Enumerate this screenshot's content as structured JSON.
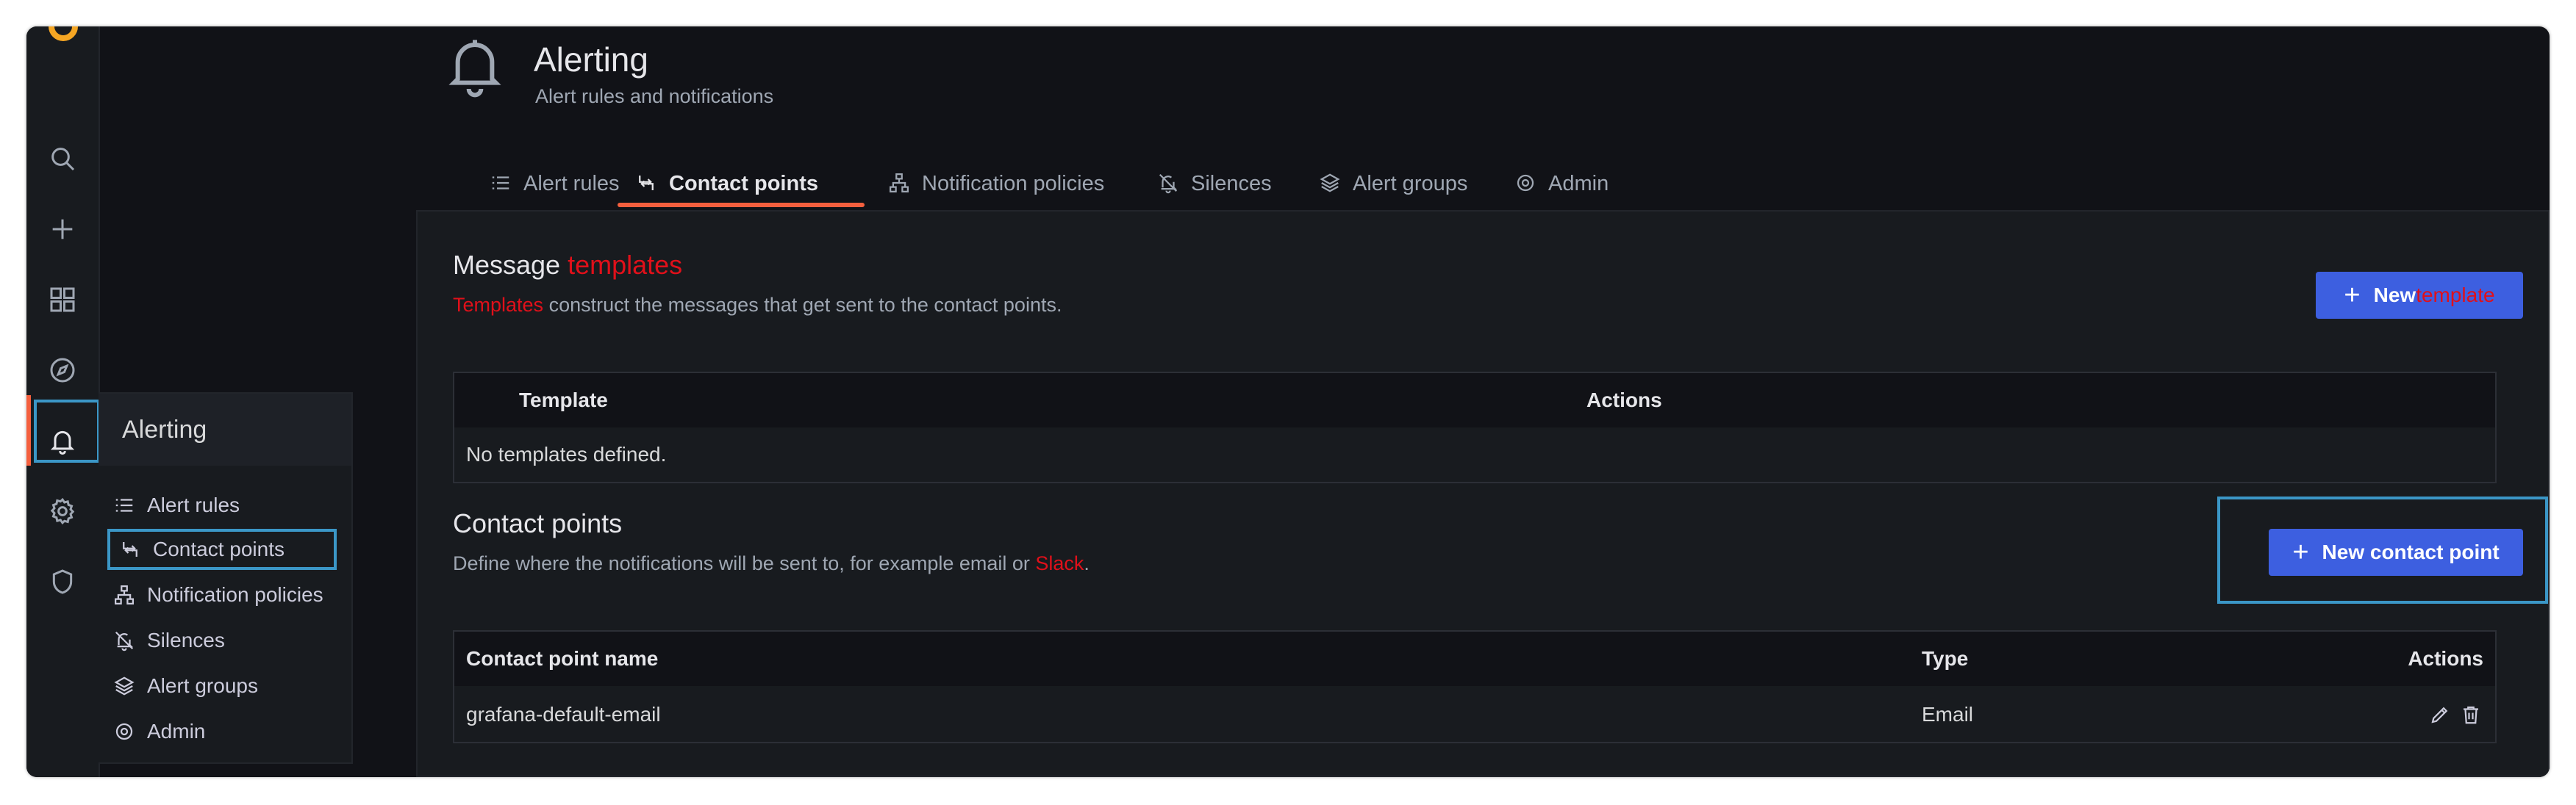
{
  "header": {
    "title": "Alerting",
    "subtitle": "Alert rules and notifications"
  },
  "tabs": [
    {
      "label": "Alert rules",
      "icon": "list-icon"
    },
    {
      "label": "Contact points",
      "icon": "contact-point-icon",
      "active": true
    },
    {
      "label": "Notification policies",
      "icon": "sitemap-icon"
    },
    {
      "label": "Silences",
      "icon": "bell-slash-icon"
    },
    {
      "label": "Alert groups",
      "icon": "layer-group-icon"
    },
    {
      "label": "Admin",
      "icon": "cog-icon"
    }
  ],
  "sidemenu": {
    "icons": [
      "search-icon",
      "plus-icon",
      "dashboards-icon",
      "explore-compass-icon",
      "bell-icon",
      "cog-icon",
      "shield-icon"
    ],
    "flyout": {
      "title": "Alerting",
      "items": [
        {
          "label": "Alert rules",
          "icon": "list-icon"
        },
        {
          "label": "Contact points",
          "icon": "contact-point-icon",
          "active": true
        },
        {
          "label": "Notification policies",
          "icon": "sitemap-icon"
        },
        {
          "label": "Silences",
          "icon": "bell-slash-icon"
        },
        {
          "label": "Alert groups",
          "icon": "layer-group-icon"
        },
        {
          "label": "Admin",
          "icon": "cog-icon"
        }
      ]
    }
  },
  "templates_section": {
    "title_prefix": "Message ",
    "title_highlight": "templates",
    "desc_highlight": "Templates",
    "desc_rest": " construct the messages that get sent to the contact points.",
    "button_plus": "+",
    "button_label": "New",
    "button_highlight": "template",
    "columns": [
      "Template",
      "Actions"
    ],
    "empty_text": "No templates defined."
  },
  "contact_points_section": {
    "title": "Contact points",
    "desc_prefix": "Define where the notifications will be sent to, for example email or ",
    "desc_highlight": "Slack",
    "desc_suffix": ".",
    "button_plus": "+",
    "button_label": "New contact point",
    "columns": [
      "Contact point name",
      "Type",
      "Actions"
    ],
    "rows": [
      {
        "name": "grafana-default-email",
        "type": "Email",
        "actions": [
          "edit-icon",
          "trash-icon"
        ]
      }
    ]
  },
  "colors": {
    "accent": "#f55f3e",
    "primary_button": "#3d5fe0",
    "highlight_box": "#3b97c7",
    "annotation_red": "#e0101a",
    "background": "#111217",
    "panel": "#181b1f"
  }
}
